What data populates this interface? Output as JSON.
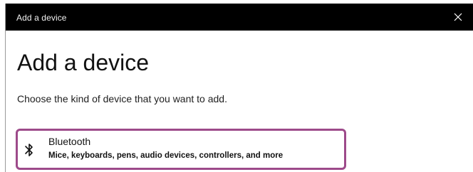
{
  "window": {
    "title": "Add a device",
    "close_glyph": "✕"
  },
  "main": {
    "heading": "Add a device",
    "subtitle": "Choose the kind of device that you want to add."
  },
  "options": [
    {
      "icon": "bluetooth-icon",
      "title": "Bluetooth",
      "description": "Mice, keyboards, pens, audio devices, controllers, and more"
    }
  ],
  "colors": {
    "titlebar_bg": "#000000",
    "focus_border": "#9d4a8a",
    "text": "#111111"
  }
}
